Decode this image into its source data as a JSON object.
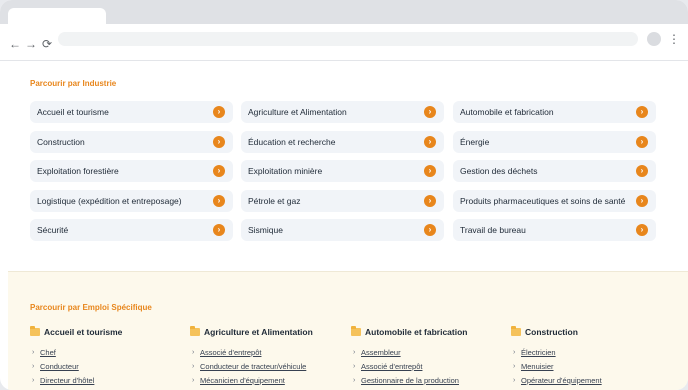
{
  "browser": {
    "back_icon": "←",
    "forward_icon": "→",
    "reload_icon": "⟳",
    "menu_icon": "⋮"
  },
  "industries": {
    "title": "Parcourir par Industrie",
    "items": [
      "Accueil et tourisme",
      "Agriculture et Alimentation",
      "Automobile et fabrication",
      "Construction",
      "Éducation et recherche",
      "Énergie",
      "Exploitation forestière",
      "Exploitation minière",
      "Gestion des déchets",
      "Logistique (expédition et entreposage)",
      "Pétrole et gaz",
      "Produits pharmaceutiques et soins de santé",
      "Sécurité",
      "Sismique",
      "Travail de bureau"
    ],
    "arrow": "›"
  },
  "jobs": {
    "title": "Parcourir par Emploi Spécifique",
    "chevron": "›",
    "groups": [
      {
        "label": "Accueil et tourisme",
        "links": [
          "Chef",
          "Conducteur",
          "Directeur d'hôtel"
        ]
      },
      {
        "label": "Agriculture et Alimentation",
        "links": [
          "Associé d'entrepôt",
          "Conducteur de tracteur/véhicule",
          "Mécanicien d'équipement"
        ]
      },
      {
        "label": "Automobile et fabrication",
        "links": [
          "Assembleur",
          "Associé d'entrepôt",
          "Gestionnaire de la production"
        ]
      },
      {
        "label": "Construction",
        "links": [
          "Électricien",
          "Menuisier",
          "Opérateur d'équipement"
        ]
      }
    ]
  }
}
